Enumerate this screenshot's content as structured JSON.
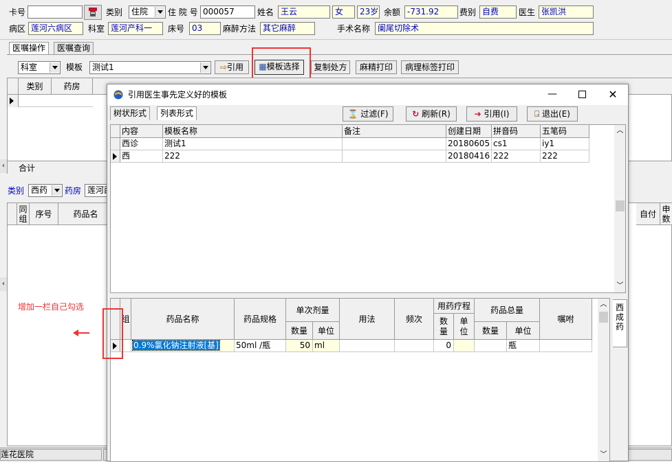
{
  "patient": {
    "card_label": "卡号",
    "card_value": "",
    "type_label": "类别",
    "type_value": "住院",
    "inpatient_label": "住 院 号",
    "inpatient_value": "000057",
    "name_label": "姓名",
    "name_value": "王云",
    "gender_value": "女",
    "age_value": "23岁",
    "balance_label": "余额",
    "balance_value": "-731.92",
    "fee_label": "费别",
    "fee_value": "自费",
    "doctor_label": "医生",
    "doctor_value": "张凯洪",
    "ward_label": "病区",
    "ward_value": "莲河六病区",
    "dept_label": "科室",
    "dept_value": "莲河产科一",
    "bed_label": "床号",
    "bed_value": "03",
    "anes_label": "麻醉方法",
    "anes_value": "其它麻醉",
    "surgery_label": "手术名称",
    "surgery_value": "阑尾切除术"
  },
  "main_tabs": [
    "医嘱操作",
    "医嘱查询"
  ],
  "toolbar": {
    "scope_value": "科室",
    "template_label": "模板",
    "template_value": "测试1",
    "cite_btn": "引用",
    "choose_btn": "模板选择",
    "copy_btn": "复制处方",
    "anes_print_btn": "麻精打印",
    "path_print_btn": "病理标签打印"
  },
  "upper_grid": {
    "headers": [
      "类别",
      "药房"
    ],
    "total_label": "合计"
  },
  "lower_bar": {
    "type_label": "类别",
    "type_value": "西药",
    "pharmacy_label": "药房",
    "pharmacy_value": "莲河西"
  },
  "lower_grid": {
    "headers": [
      "同组",
      "序号",
      "药品名"
    ],
    "right_headers": [
      "自付",
      "申数"
    ]
  },
  "annotation": "增加一栏自己勾选",
  "status_bar": {
    "hospital": "莲花医院"
  },
  "dialog": {
    "title": "引用医生事先定义好的模板",
    "tabs": [
      "树状形式",
      "列表形式"
    ],
    "filter_btn": "过滤(F)",
    "refresh_btn": "刷新(R)",
    "cite_btn": "引用(I)",
    "exit_btn": "退出(E)",
    "template_table": {
      "headers": [
        "内容",
        "模板名称",
        "备注",
        "创建日期",
        "拼音码",
        "五笔码"
      ],
      "rows": [
        [
          "西诊",
          "测试1",
          "",
          "20180605",
          "cs1",
          "iy1"
        ],
        [
          "西",
          "222",
          "",
          "20180416",
          "222",
          "222"
        ]
      ]
    },
    "drug_table": {
      "group_header": "组",
      "name_header": "药品名称",
      "spec_header": "药品规格",
      "dose_header": "单次剂量",
      "dose_qty": "数量",
      "dose_unit": "单位",
      "usage_header": "用法",
      "freq_header": "频次",
      "course_header": "用药疗程",
      "course_qty": "数量",
      "course_unit": "单位",
      "total_header": "药品总量",
      "total_qty": "数量",
      "total_unit": "单位",
      "note_header": "嘱咐",
      "side_tab": "西成药",
      "row": {
        "name": "0.9%氯化钠注射液[基]",
        "spec": "50ml /瓶",
        "dose_qty": "50",
        "dose_unit": "ml",
        "course_qty": "0",
        "total_unit": "瓶"
      }
    }
  }
}
